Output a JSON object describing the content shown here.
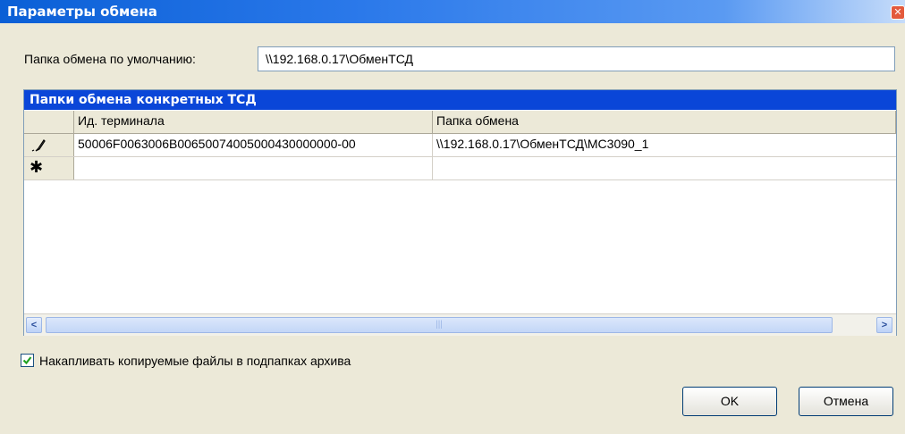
{
  "window": {
    "title": "Параметры обмена"
  },
  "default_folder": {
    "label": "Папка обмена по умолчанию:",
    "value": "\\\\192.168.0.17\\ОбменТСД"
  },
  "terminals_panel": {
    "title": "Папки обмена конкретных ТСД",
    "columns": [
      "Ид. терминала",
      "Папка обмена"
    ],
    "rows": [
      {
        "marker_icon": "pencil-icon",
        "terminal_id": "50006F0063006B00650074005000430000000-00",
        "folder": "\\\\192.168.0.17\\ОбменТСД\\MC3090_1"
      }
    ],
    "new_row_marker": "new-row-asterisk-icon"
  },
  "accumulate": {
    "checked": true,
    "label": "Накапливать копируемые файлы в подпапках архива"
  },
  "buttons": {
    "ok": "OK",
    "cancel": "Отмена"
  },
  "colors": {
    "titlebar": "#0a5fd6",
    "panel_header": "#0a46d8",
    "dialog_bg": "#ece9d8"
  }
}
